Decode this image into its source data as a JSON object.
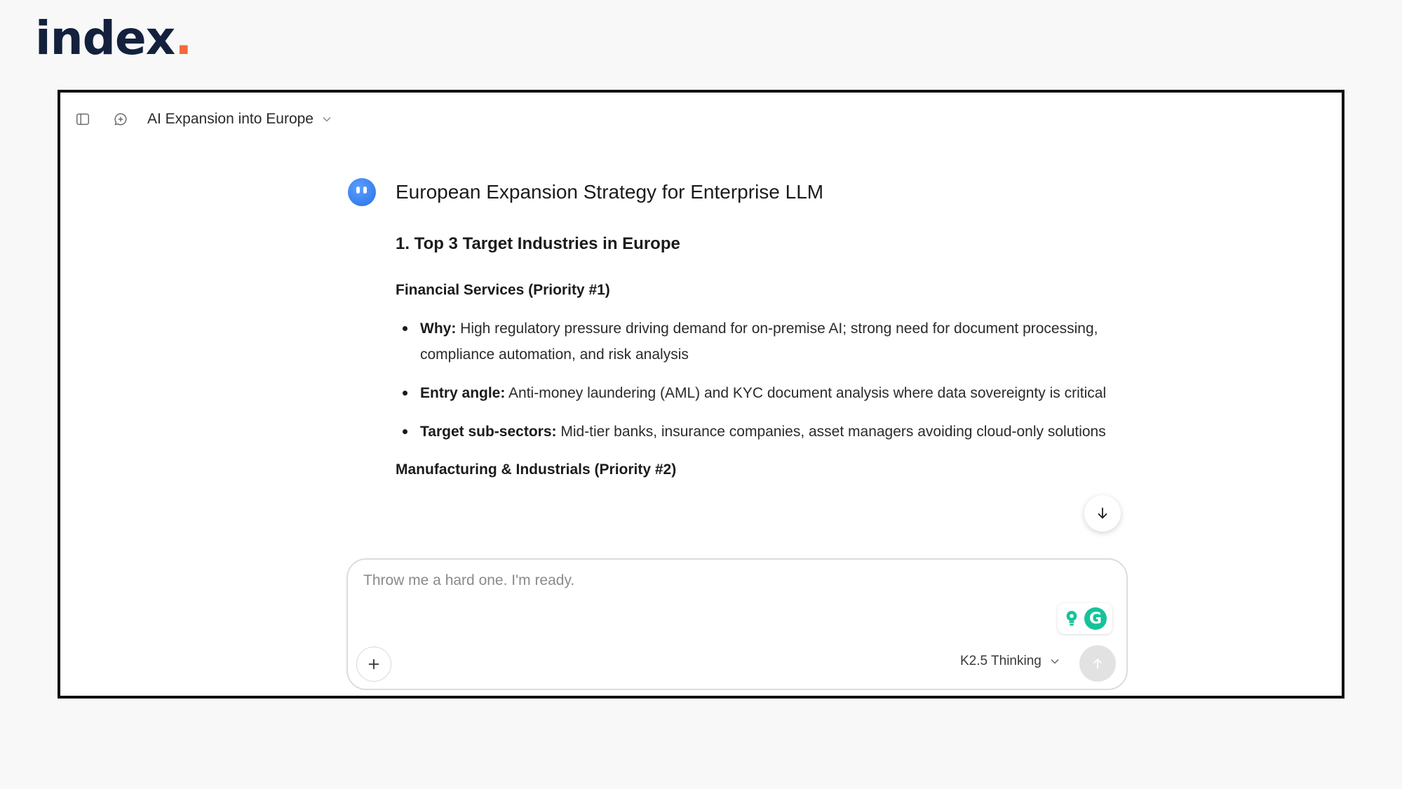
{
  "brand": {
    "name": "index",
    "dot": "."
  },
  "topbar": {
    "chat_title": "AI Expansion into Europe"
  },
  "message": {
    "heading": "European Expansion Strategy for Enterprise LLM",
    "section_title": "1. Top 3 Target Industries in Europe",
    "industry_1": {
      "title": "Financial Services (Priority #1)",
      "bullets": [
        {
          "label": "Why:",
          "text": " High regulatory pressure driving demand for on-premise AI; strong need for document processing, compliance automation, and risk analysis"
        },
        {
          "label": "Entry angle:",
          "text": " Anti-money laundering (AML) and KYC document analysis where data sovereignty is critical"
        },
        {
          "label": "Target sub-sectors:",
          "text": " Mid-tier banks, insurance companies, asset managers avoiding cloud-only solutions"
        }
      ]
    },
    "industry_2": {
      "title": "Manufacturing & Industrials (Priority #2)"
    }
  },
  "composer": {
    "placeholder": "Throw me a hard one. I'm ready.",
    "model_label": "K2.5 Thinking"
  },
  "colors": {
    "brand_navy": "#14213d",
    "brand_dot": "#f26a3d",
    "avatar_blue": "#2a6fe6",
    "grammarly_green": "#15c39a"
  },
  "icons": {
    "sidebar_toggle": "sidebar-toggle-icon",
    "new_chat": "new-chat-icon",
    "title_dropdown": "chevron-down-icon",
    "scroll_down": "arrow-down-icon",
    "attach": "plus-icon",
    "send": "arrow-up-icon",
    "grammarly": "grammarly-icon"
  }
}
